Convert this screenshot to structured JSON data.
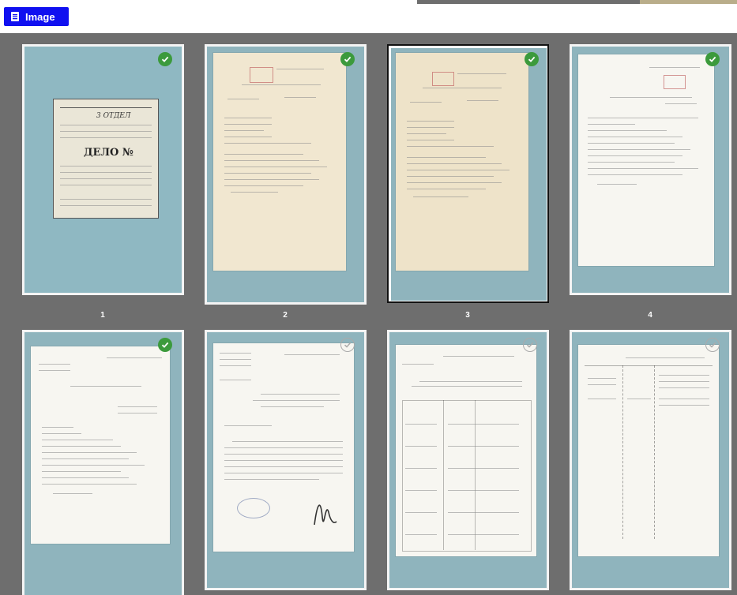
{
  "toolbar": {
    "image_button_label": "Image",
    "image_button_icon": "document-icon"
  },
  "accent_color": "#1010f0",
  "selected_item": "3",
  "items": [
    {
      "label": "1",
      "checked": true
    },
    {
      "label": "2",
      "checked": true
    },
    {
      "label": "3",
      "checked": true
    },
    {
      "label": "4",
      "checked": true
    },
    {
      "label": "",
      "checked": true
    },
    {
      "label": "",
      "checked": false
    },
    {
      "label": "",
      "checked": false
    },
    {
      "label": "",
      "checked": false
    }
  ],
  "folder_cover": {
    "header": "3 ОТДЕЛ",
    "title": "ДЕЛО №"
  }
}
